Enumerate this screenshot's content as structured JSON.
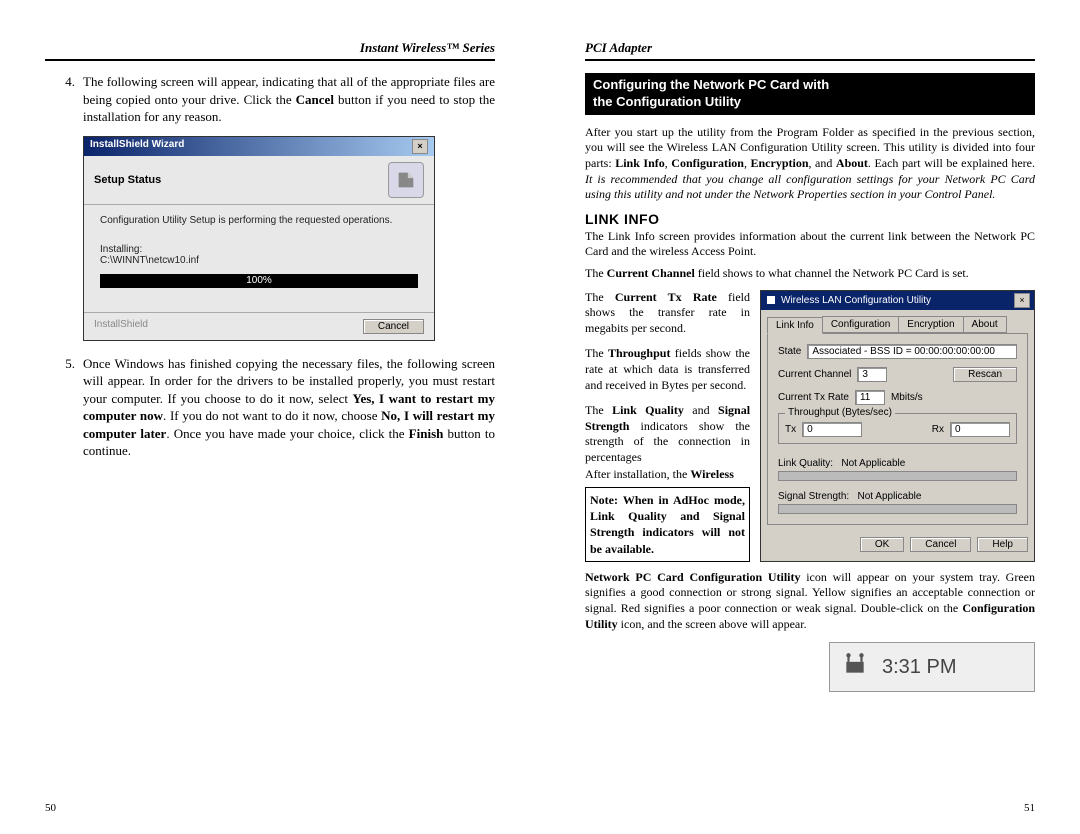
{
  "left": {
    "header": "Instant Wireless™ Series",
    "pageNum": "50",
    "step4": {
      "num": "4.",
      "text_before": "The following screen will appear, indicating that all of the appropriate files are being copied onto your drive.  Click the ",
      "bold1": "Cancel",
      "text_after": " button if you need to stop the installation for any reason."
    },
    "dialog": {
      "title": "InstallShield Wizard",
      "heading": "Setup Status",
      "line1": "Configuration Utility Setup is performing the requested operations.",
      "installing": "Installing:",
      "path": "C:\\WINNT\\netcw10.inf",
      "progress": "100%",
      "brand": "InstallShield",
      "cancel": "Cancel"
    },
    "step5": {
      "num": "5.",
      "t1": "Once Windows has finished copying the necessary files, the following screen will appear.  In order for the drivers to be installed properly, you must restart your computer.  If you choose to do it now, select ",
      "b1": "Yes, I want to restart my computer now",
      "t2": ".   If you do not want to do it now, choose ",
      "b2": "No, I will restart my computer later",
      "t3": ".  Once you have made your choice, click the ",
      "b3": "Finish",
      "t4": " button to continue."
    }
  },
  "right": {
    "header": "PCI Adapter",
    "pageNum": "51",
    "sectionTitle1": "Configuring the Network PC Card with",
    "sectionTitle2": "the Configuration Utility",
    "intro": {
      "t1": "After you start up the utility from the Program Folder as specified in the previous section, you will see the Wireless LAN Configuration Utility screen. This utility is divided into four parts: ",
      "b1": "Link Info",
      "c1": ", ",
      "b2": "Configuration",
      "c2": ", ",
      "b3": "Encryption",
      "c3": ", and ",
      "b4": "About",
      "t2": ". Each part will be explained here. ",
      "i1": "It is recommended that you change all configuration settings for your Network PC Card using this utility and not under the Network Properties section in your Control Panel."
    },
    "linkInfoHeading": "LINK INFO",
    "linkInfoIntro": "The Link Info screen provides information about the current link between the Network PC Card and the wireless Access Point.",
    "chTxt1": "The ",
    "chBold": "Current Channel",
    "chTxt2": " field shows to what channel the Network PC Card is set.",
    "colText": {
      "tx1": "The ",
      "b1": "Current Tx Rate",
      "tx2": " field shows the transfer rate in megabits per second.",
      "tp1": "The ",
      "b2": "Throughput",
      "tp2": " fields show the rate at which data is transferred and received in Bytes per second.",
      "lq1": "The ",
      "b3": "Link Quality",
      "lq2": " and ",
      "b4": "Signal Strength",
      "lq3": " indicators show the strength of the connection in percentages",
      "after1": "After installation, the ",
      "b5": "Wireless"
    },
    "note": "Note: When in AdHoc mode, Link Quality and Signal Strength indicators will not be available.",
    "footer": {
      "b1": "Network PC Card Configuration Utility",
      "t1": " icon will appear on your system tray. Green signifies a good connection or strong signal. Yellow signifies an acceptable connection or signal. Red signifies a poor connection or weak signal. Double-click on the ",
      "b2": "Configuration Utility",
      "t2": " icon, and the screen above will appear."
    },
    "cfgDialog": {
      "title": "Wireless LAN Configuration Utility",
      "tabs": [
        "Link Info",
        "Configuration",
        "Encryption",
        "About"
      ],
      "stateLabel": "State",
      "stateValue": "Associated - BSS ID = 00:00:00:00:00:00",
      "chLabel": "Current Channel",
      "chValue": "3",
      "rescBtn": "Rescan",
      "txLabel": "Current Tx Rate",
      "txValue": "11",
      "txUnit": "Mbits/s",
      "throughput": "Throughput (Bytes/sec)",
      "txl": "Tx",
      "txv": "0",
      "rxl": "Rx",
      "rxv": "0",
      "lqLabel": "Link Quality:",
      "lqValue": "Not Applicable",
      "ssLabel": "Signal Strength:",
      "ssValue": "Not Applicable",
      "ok": "OK",
      "cancel": "Cancel",
      "help": "Help"
    },
    "trayTime": "3:31 PM"
  }
}
